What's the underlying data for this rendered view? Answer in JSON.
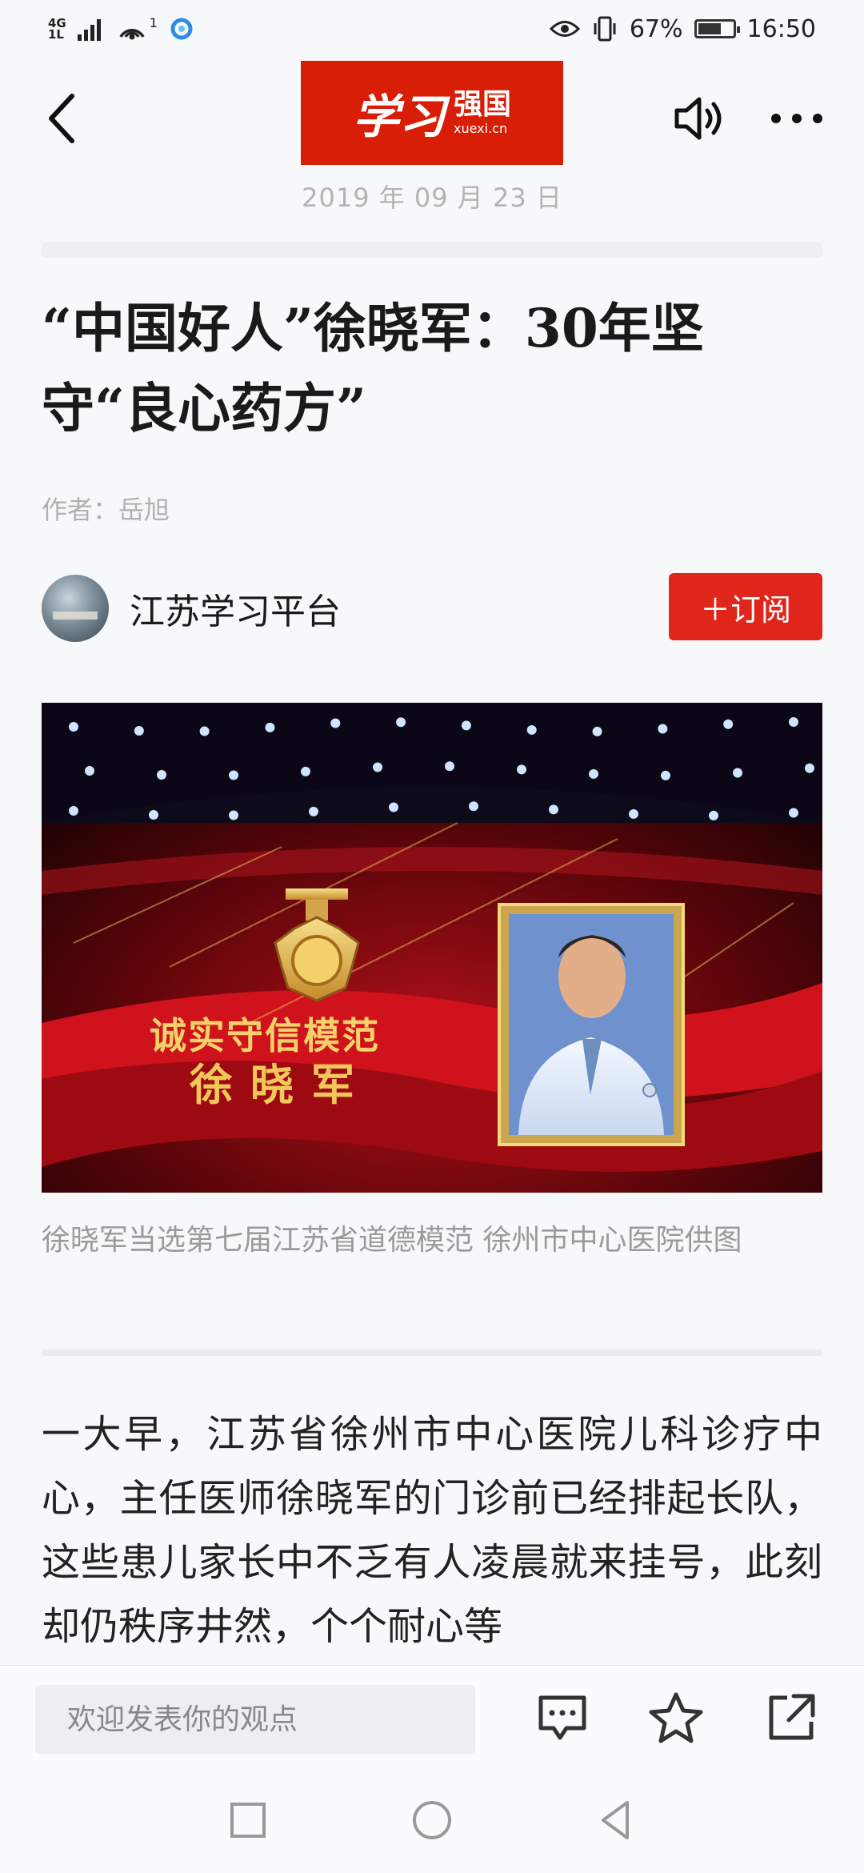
{
  "status_bar": {
    "network_top": "4G",
    "network_bottom": "1L",
    "wifi_superscript": "1",
    "battery_percent": "67%",
    "battery_level": 0.67,
    "time": "16:50"
  },
  "header": {
    "logo_script": "学习",
    "logo_text": "强国",
    "logo_url": "xuexi.cn",
    "date": "2019 年 09 月 23 日"
  },
  "colors": {
    "accent": "#d81e06",
    "subscribe": "#e0251b",
    "background": "#f7f8fa"
  },
  "article": {
    "title": "“中国好人”徐晓军：30年坚守“良心药方”",
    "author": "作者：岳旭",
    "source": {
      "name": "江苏学习平台",
      "subscribe_label": "＋订阅"
    },
    "image": {
      "banner_title": "诚实守信模范",
      "banner_name": "徐晓军"
    },
    "caption": "徐晓军当选第七届江苏省道德模范 徐州市中心医院供图",
    "body": "一大早，江苏省徐州市中心医院儿科诊疗中心，主任医师徐晓军的门诊前已经排起长队，这些患儿家长中不乏有人凌晨就来挂号，此刻却仍秩序井然，个个耐心等"
  },
  "bottom_bar": {
    "comment_placeholder": "欢迎发表你的观点",
    "icons": [
      "comment-icon",
      "star-icon",
      "share-icon"
    ]
  },
  "nav_bar": {
    "icons": [
      "recent-apps-icon",
      "home-icon",
      "back-nav-icon"
    ]
  }
}
